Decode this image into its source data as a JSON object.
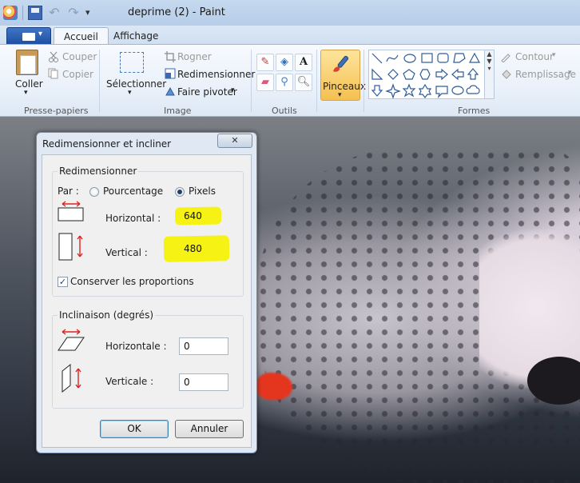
{
  "window": {
    "title": "deprime (2) - Paint"
  },
  "tabs": [
    {
      "label": "Accueil",
      "active": true
    },
    {
      "label": "Affichage",
      "active": false
    }
  ],
  "ribbon": {
    "clipboard": {
      "paste_label": "Coller",
      "cut_label": "Couper",
      "copy_label": "Copier",
      "group_label": "Presse-papiers"
    },
    "image": {
      "select_label": "Sélectionner",
      "crop_label": "Rogner",
      "resize_label": "Redimensionner",
      "rotate_label": "Faire pivoter",
      "group_label": "Image"
    },
    "tools": {
      "group_label": "Outils"
    },
    "brushes": {
      "label": "Pinceaux"
    },
    "shapes": {
      "outline_label": "Contour",
      "fill_label": "Remplissage",
      "group_label": "Formes"
    }
  },
  "dialog": {
    "title": "Redimensionner et incliner",
    "resize": {
      "legend": "Redimensionner",
      "by_label": "Par :",
      "percent_label": "Pourcentage",
      "pixels_label": "Pixels",
      "selected_unit": "Pixels",
      "horizontal_label": "Horizontal :",
      "horizontal_value": "640",
      "vertical_label": "Vertical :",
      "vertical_value": "480",
      "keep_ratio_label": "Conserver les proportions",
      "keep_ratio_checked": true
    },
    "skew": {
      "legend": "Inclinaison (degrés)",
      "horizontal_label": "Horizontale :",
      "horizontal_value": "0",
      "vertical_label": "Verticale :",
      "vertical_value": "0"
    },
    "ok_label": "OK",
    "cancel_label": "Annuler"
  },
  "colors": {
    "highlight": "#f5f214",
    "brush_active": "#f5c051",
    "accent": "#1d4f9f"
  }
}
